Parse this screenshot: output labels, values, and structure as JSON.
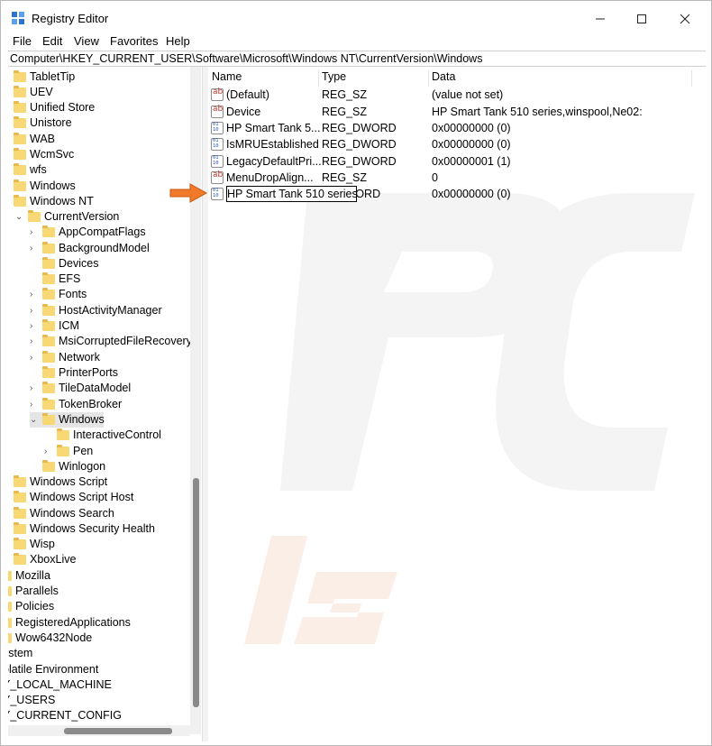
{
  "window": {
    "title": "Registry Editor"
  },
  "menu": [
    "File",
    "Edit",
    "View",
    "Favorites",
    "Help"
  ],
  "address": "Computer\\HKEY_CURRENT_USER\\Software\\Microsoft\\Windows NT\\CurrentVersion\\Windows",
  "tree": [
    {
      "label": "TabletTip"
    },
    {
      "label": "UEV"
    },
    {
      "label": "Unified Store"
    },
    {
      "label": "Unistore"
    },
    {
      "label": "WAB"
    },
    {
      "label": "WcmSvc"
    },
    {
      "label": "wfs"
    },
    {
      "label": "Windows"
    },
    {
      "label": "Windows NT"
    },
    {
      "label": "CurrentVersion"
    },
    {
      "label": "AppCompatFlags"
    },
    {
      "label": "BackgroundModel"
    },
    {
      "label": "Devices"
    },
    {
      "label": "EFS"
    },
    {
      "label": "Fonts"
    },
    {
      "label": "HostActivityManager"
    },
    {
      "label": "ICM"
    },
    {
      "label": "MsiCorruptedFileRecovery"
    },
    {
      "label": "Network"
    },
    {
      "label": "PrinterPorts"
    },
    {
      "label": "TileDataModel"
    },
    {
      "label": "TokenBroker"
    },
    {
      "label": "Windows"
    },
    {
      "label": "InteractiveControl"
    },
    {
      "label": "Pen"
    },
    {
      "label": "Winlogon"
    },
    {
      "label": "Windows Script"
    },
    {
      "label": "Windows Script Host"
    },
    {
      "label": "Windows Search"
    },
    {
      "label": "Windows Security Health"
    },
    {
      "label": "Wisp"
    },
    {
      "label": "XboxLive"
    },
    {
      "label": "Mozilla"
    },
    {
      "label": "Parallels"
    },
    {
      "label": "Policies"
    },
    {
      "label": "RegisteredApplications"
    },
    {
      "label": "Wow6432Node"
    },
    {
      "label": "ystem"
    },
    {
      "label": "olatile Environment"
    },
    {
      "label": "Y_LOCAL_MACHINE"
    },
    {
      "label": "Y_USERS"
    },
    {
      "label": "Y_CURRENT_CONFIG"
    }
  ],
  "columns": {
    "name": "Name",
    "type": "Type",
    "data": "Data"
  },
  "values": [
    {
      "name": "(Default)",
      "type": "REG_SZ",
      "data": "(value not set)",
      "icon": "string-value-icon"
    },
    {
      "name": "Device",
      "type": "REG_SZ",
      "data": "HP Smart Tank 510 series,winspool,Ne02:",
      "icon": "string-value-icon"
    },
    {
      "name": "HP Smart Tank 5...",
      "type": "REG_DWORD",
      "data": "0x00000000 (0)",
      "icon": "dword-value-icon"
    },
    {
      "name": "IsMRUEstablished",
      "type": "REG_DWORD",
      "data": "0x00000000 (0)",
      "icon": "dword-value-icon"
    },
    {
      "name": "LegacyDefaultPri...",
      "type": "REG_DWORD",
      "data": "0x00000001 (1)",
      "icon": "dword-value-icon"
    },
    {
      "name": "MenuDropAlign...",
      "type": "REG_SZ",
      "data": "0",
      "icon": "string-value-icon"
    },
    {
      "name": "HP Smart Tank 510 series",
      "type": "VORD",
      "data": "0x00000000 (0)",
      "icon": "dword-value-icon"
    }
  ],
  "colors": {
    "folder": "#f8d775",
    "arrow": "#f07a2a",
    "selection": "#e5e5e5"
  }
}
